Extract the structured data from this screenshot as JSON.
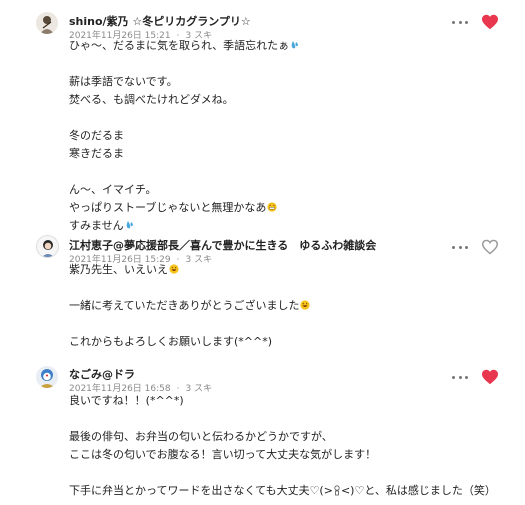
{
  "comments": [
    {
      "author": "shino/紫乃 ☆冬ピリカグランプリ☆",
      "date": "2021年11月26日 15:21",
      "likes": "3 スキ",
      "liked": true,
      "lines": [
        "ひゃ〜、だるまに気を取られ、季語忘れたぁ",
        "",
        "薪は季語でないです。",
        "焚べる、も調べたけれどダメね。",
        "",
        "冬のだるま",
        "寒きだるま",
        "",
        "ん〜、イマイチ。",
        "やっぱりストーブじゃないと無理かなあ",
        "すみません"
      ]
    },
    {
      "author": "江村恵子@夢応援部長／喜んで豊かに生きる　ゆるふわ雑談会",
      "date": "2021年11月26日 15:29",
      "likes": "3 スキ",
      "liked": false,
      "lines": [
        "紫乃先生、いえいえ",
        "",
        "一緒に考えていただきありがとうございました",
        "",
        "これからもよろしくお願いします(*^^*)"
      ]
    },
    {
      "author": "なごみ@ドラ",
      "date": "2021年11月26日 16:58",
      "likes": "3 スキ",
      "liked": true,
      "lines": [
        "良いですね！！(*^^*)",
        "",
        "最後の俳句、お弁当の匂いと伝わるかどうかですが、",
        "ここは冬の匂いでお腹なる！言い切って大丈夫な気がします！",
        "",
        "下手に弁当とかってワードを出さなくても大丈夫♡(>",
        "<)♡と、私は感じました（笑）"
      ]
    }
  ],
  "colors": {
    "heart_liked": "#e8374f",
    "heart_outline": "#9a9a9a",
    "meta": "#8a8a8a"
  },
  "icons": {
    "more": "more-dots-icon",
    "like": "heart-icon",
    "sweat": "sweat-drop-emoji",
    "grin": "grinning-face-emoji",
    "figure": "figure-emoji"
  }
}
